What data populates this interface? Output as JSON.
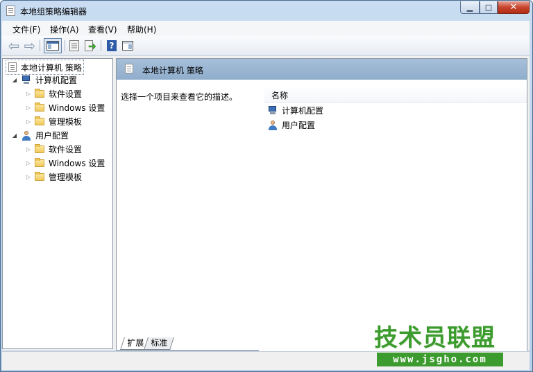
{
  "window": {
    "title": "本地组策略编辑器"
  },
  "menu": [
    "文件(F)",
    "操作(A)",
    "查看(V)",
    "帮助(H)"
  ],
  "toolbar": {
    "help_glyph": "?"
  },
  "tree": {
    "root": "本地计算机 策略",
    "computer": {
      "label": "计算机配置",
      "children": [
        "软件设置",
        "Windows 设置",
        "管理模板"
      ]
    },
    "user": {
      "label": "用户配置",
      "children": [
        "软件设置",
        "Windows 设置",
        "管理模板"
      ]
    }
  },
  "right": {
    "header": "本地计算机 策略",
    "description": "选择一个项目来查看它的描述。",
    "column_name": "名称",
    "items": [
      "计算机配置",
      "用户配置"
    ]
  },
  "tabs": [
    "扩展",
    "标准"
  ],
  "watermark": {
    "text": "技术员联盟",
    "url": "www.jsgho.com"
  }
}
